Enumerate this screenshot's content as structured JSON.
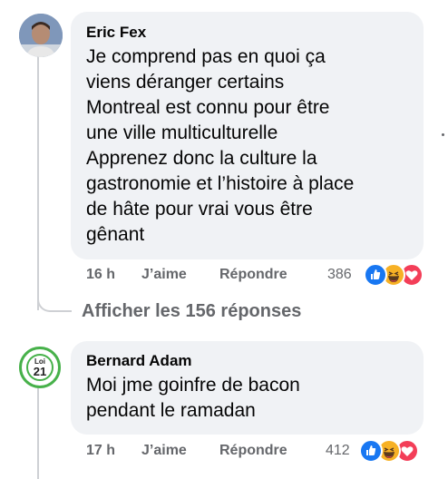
{
  "comments": [
    {
      "author": "Eric Fex",
      "lines": [
        "Je comprend pas en quoi ça",
        "viens déranger certains",
        "Montreal est connu pour être",
        "une ville multiculturelle",
        "Apprenez donc la culture la",
        "gastronomie et l’histoire à place",
        "de hâte pour vrai vous être",
        "gênant"
      ],
      "time": "16 h",
      "like_label": "J’aime",
      "reply_label": "Répondre",
      "reaction_count": "386",
      "reactions": [
        "like-icon",
        "haha-icon",
        "love-icon"
      ]
    },
    {
      "author": "Bernard Adam",
      "avatar_text_top": "Loi",
      "avatar_text_bottom": "21",
      "lines": [
        "Moi jme goinfre de bacon",
        "pendant le ramadan"
      ],
      "time": "17 h",
      "like_label": "J’aime",
      "reply_label": "Répondre",
      "reaction_count": "412",
      "reactions": [
        "like-icon",
        "haha-icon",
        "love-icon"
      ]
    }
  ],
  "view_replies": "Afficher les 156 réponses",
  "colors": {
    "bubble": "#f0f2f5",
    "meta": "#65676b",
    "like": "#1877f2",
    "haha": "#f7b125",
    "love": "#f33e58",
    "badge_green": "#47b14a"
  }
}
